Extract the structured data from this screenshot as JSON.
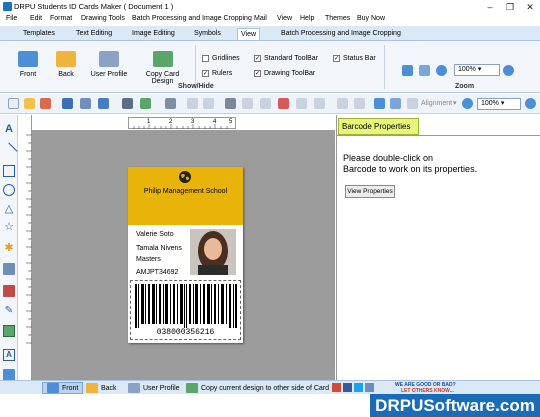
{
  "window": {
    "title": "DRPU Students ID Cards Maker ( Document 1 )"
  },
  "menu": [
    "File",
    "Edit",
    "Format",
    "Drawing Tools",
    "Batch Processing and Image Cropping",
    "Mail",
    "View",
    "Help",
    "Themes",
    "Buy Now"
  ],
  "tabs": [
    "Templates",
    "Text Editing",
    "Image Editing",
    "Symbols",
    "View",
    "Batch Processing and Image Cropping"
  ],
  "active_tab": "View",
  "ribbon": {
    "buttons": [
      "Front",
      "Back",
      "User Profile",
      "Copy Card Design"
    ],
    "checkboxes": [
      {
        "label": "Gridlines",
        "checked": false
      },
      {
        "label": "Rulers",
        "checked": true
      },
      {
        "label": "Standard ToolBar",
        "checked": true
      },
      {
        "label": "Drawing ToolBar",
        "checked": true
      },
      {
        "label": "Status Bar",
        "checked": true
      }
    ],
    "group_showhide": "Show/Hide",
    "group_zoom": "Zoom",
    "zoom_value": "100%"
  },
  "toolbar2": {
    "alignment_label": "Alignment",
    "zoom_value": "100%"
  },
  "ruler_top": [
    "1",
    "2",
    "3",
    "4",
    "5"
  ],
  "card": {
    "school": "Philip Management School",
    "name": "Valerie Soto",
    "parent": "Tamala Nivens",
    "course": "Masters",
    "id": "AMJPT34692",
    "barcode": "038000356216"
  },
  "right_panel": {
    "tab": "Barcode Properties",
    "message_line1": "Please double-click on",
    "message_line2": "Barcode to work on its properties.",
    "button": "View Properties"
  },
  "bottom": {
    "front": "Front",
    "back": "Back",
    "profile": "User Profile",
    "copy": "Copy current design to other side of Card",
    "feedback_line1": "WE ARE GOOD OR BAD?",
    "feedback_line2": "LET OTHERS KNOW..."
  },
  "brand": "DRPUSoftware.com",
  "colors": {
    "card_header": "#e8b40a",
    "brand_bg": "#1a6bb8",
    "canvas": "#9c9c9c"
  }
}
